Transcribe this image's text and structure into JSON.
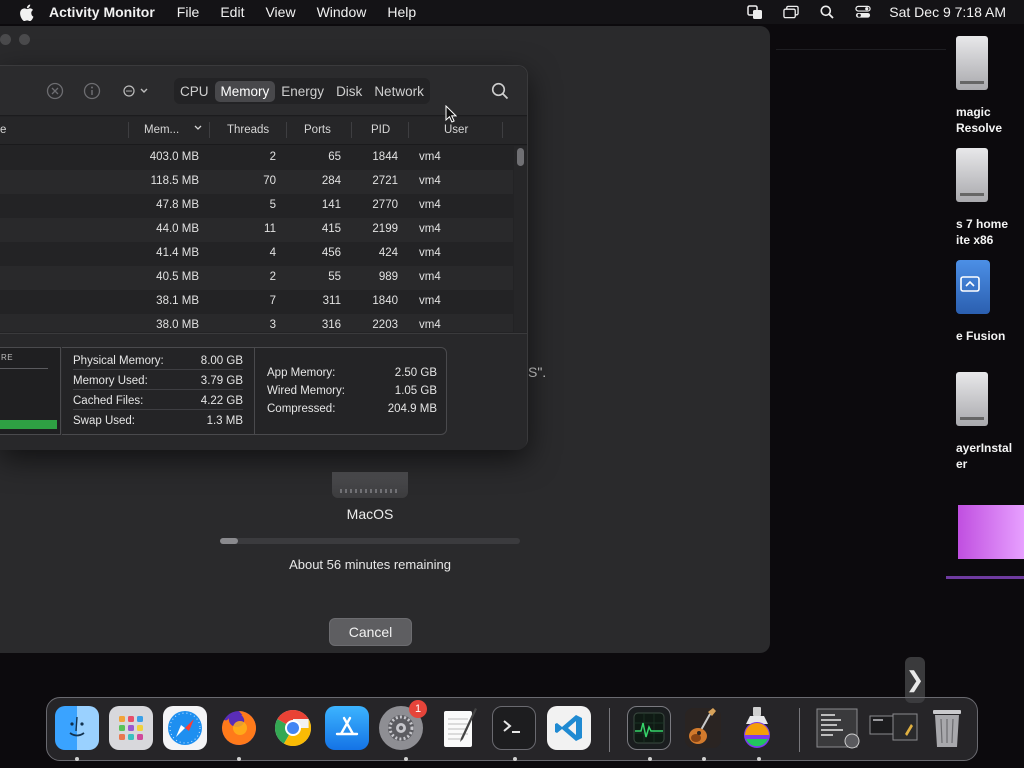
{
  "menubar": {
    "app_name": "Activity Monitor",
    "items": [
      "File",
      "Edit",
      "View",
      "Window",
      "Help"
    ],
    "clock": "Sat Dec 9  7:18 AM"
  },
  "installer": {
    "disk_label": "MacOS",
    "progress_fraction": 0.06,
    "remaining": "About 56 minutes remaining",
    "cancel_label": "Cancel",
    "quote_fragment": "S\"."
  },
  "desktop_items": [
    {
      "line1": "magic",
      "line2": "Resolve"
    },
    {
      "line1": "s 7 home",
      "line2": "ite x86"
    },
    {
      "line1": "e Fusion",
      "line2": ""
    },
    {
      "line1": "ayerInstal",
      "line2": "er"
    }
  ],
  "activity_monitor": {
    "tabs": [
      "CPU",
      "Memory",
      "Energy",
      "Disk",
      "Network"
    ],
    "selected_tab": "Memory",
    "columns": {
      "name": "e",
      "memory": "Mem...",
      "threads": "Threads",
      "ports": "Ports",
      "pid": "PID",
      "user": "User"
    },
    "rows": [
      {
        "memory": "403.0 MB",
        "threads": "2",
        "ports": "65",
        "pid": "1844",
        "user": "vm4"
      },
      {
        "memory": "118.5 MB",
        "threads": "70",
        "ports": "284",
        "pid": "2721",
        "user": "vm4"
      },
      {
        "memory": "47.8 MB",
        "threads": "5",
        "ports": "141",
        "pid": "2770",
        "user": "vm4"
      },
      {
        "memory": "44.0 MB",
        "threads": "11",
        "ports": "415",
        "pid": "2199",
        "user": "vm4"
      },
      {
        "memory": "41.4 MB",
        "threads": "4",
        "ports": "456",
        "pid": "424",
        "user": "vm4"
      },
      {
        "memory": "40.5 MB",
        "threads": "2",
        "ports": "55",
        "pid": "989",
        "user": "vm4"
      },
      {
        "memory": "38.1 MB",
        "threads": "7",
        "ports": "311",
        "pid": "1840",
        "user": "vm4"
      },
      {
        "memory": "38.0 MB",
        "threads": "3",
        "ports": "316",
        "pid": "2203",
        "user": "vm4"
      }
    ],
    "pressure_label": "RE",
    "memory_stats": [
      {
        "label": "Physical Memory:",
        "value": "8.00 GB"
      },
      {
        "label": "Memory Used:",
        "value": "3.79 GB"
      },
      {
        "label": "Cached Files:",
        "value": "4.22 GB"
      },
      {
        "label": "Swap Used:",
        "value": "1.3 MB"
      }
    ],
    "app_stats": [
      {
        "label": "App Memory:",
        "value": "2.50 GB"
      },
      {
        "label": "Wired Memory:",
        "value": "1.05 GB"
      },
      {
        "label": "Compressed:",
        "value": "204.9 MB"
      }
    ]
  },
  "dock": {
    "items": [
      {
        "name": "finder",
        "running": true
      },
      {
        "name": "launchpad",
        "running": false
      },
      {
        "name": "safari",
        "running": false
      },
      {
        "name": "firefox",
        "running": true
      },
      {
        "name": "chrome",
        "running": false
      },
      {
        "name": "app-store",
        "running": false
      },
      {
        "name": "system-settings",
        "running": true,
        "badge": "1"
      },
      {
        "name": "textedit",
        "running": false
      },
      {
        "name": "terminal",
        "running": true
      },
      {
        "name": "vscode",
        "running": false
      },
      {
        "name": "activity-monitor",
        "running": true
      },
      {
        "name": "garageband",
        "running": true
      },
      {
        "name": "macos-installer",
        "running": true
      },
      {
        "name": "downloads-stack",
        "running": false
      },
      {
        "name": "screenshots-stack",
        "running": false
      },
      {
        "name": "trash",
        "running": false
      }
    ]
  },
  "colors": {
    "accent_green": "#2ea043",
    "badge_red": "#e5443a"
  }
}
